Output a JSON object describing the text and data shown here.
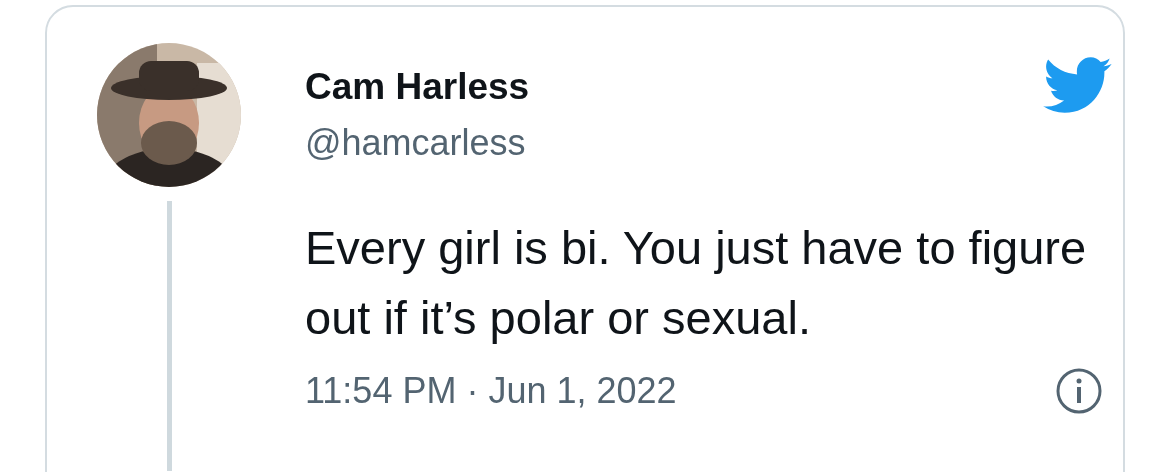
{
  "tweet": {
    "author": {
      "name": "Cam Harless",
      "handle": "@hamcarless"
    },
    "text": "Every girl is bi. You just have to figure out if it’s polar or sexual.",
    "timestamp": "11:54 PM · Jun 1, 2022"
  }
}
